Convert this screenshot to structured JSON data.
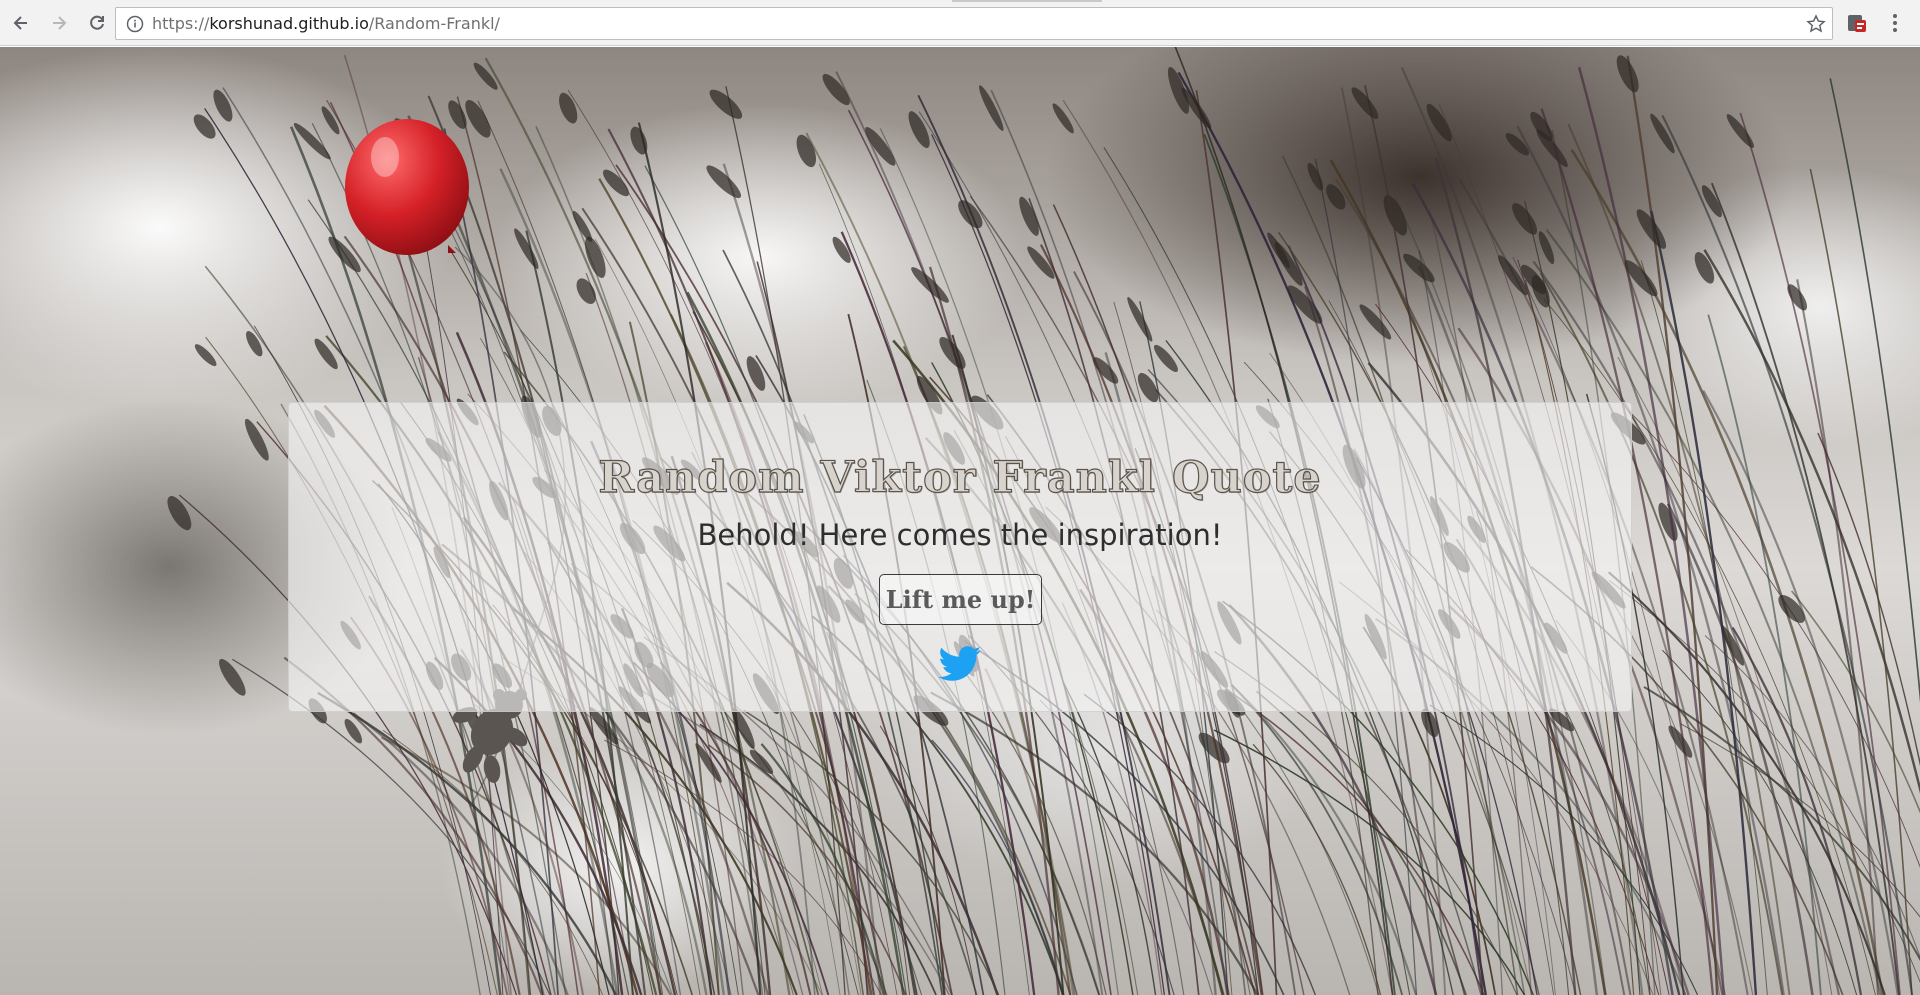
{
  "browser": {
    "url_host": "korshunad.github.io",
    "url_path": "/Random-Frankl/",
    "url_prefix": "https://"
  },
  "card": {
    "title": "Random Viktor Frankl Quote",
    "subtitle": "Behold! Here comes the inspiration!",
    "button_label": "Lift me up!",
    "twitter_icon": "twitter-bird-icon"
  },
  "colors": {
    "twitter_blue": "#1da1f2",
    "balloon_red": "#d42027"
  }
}
